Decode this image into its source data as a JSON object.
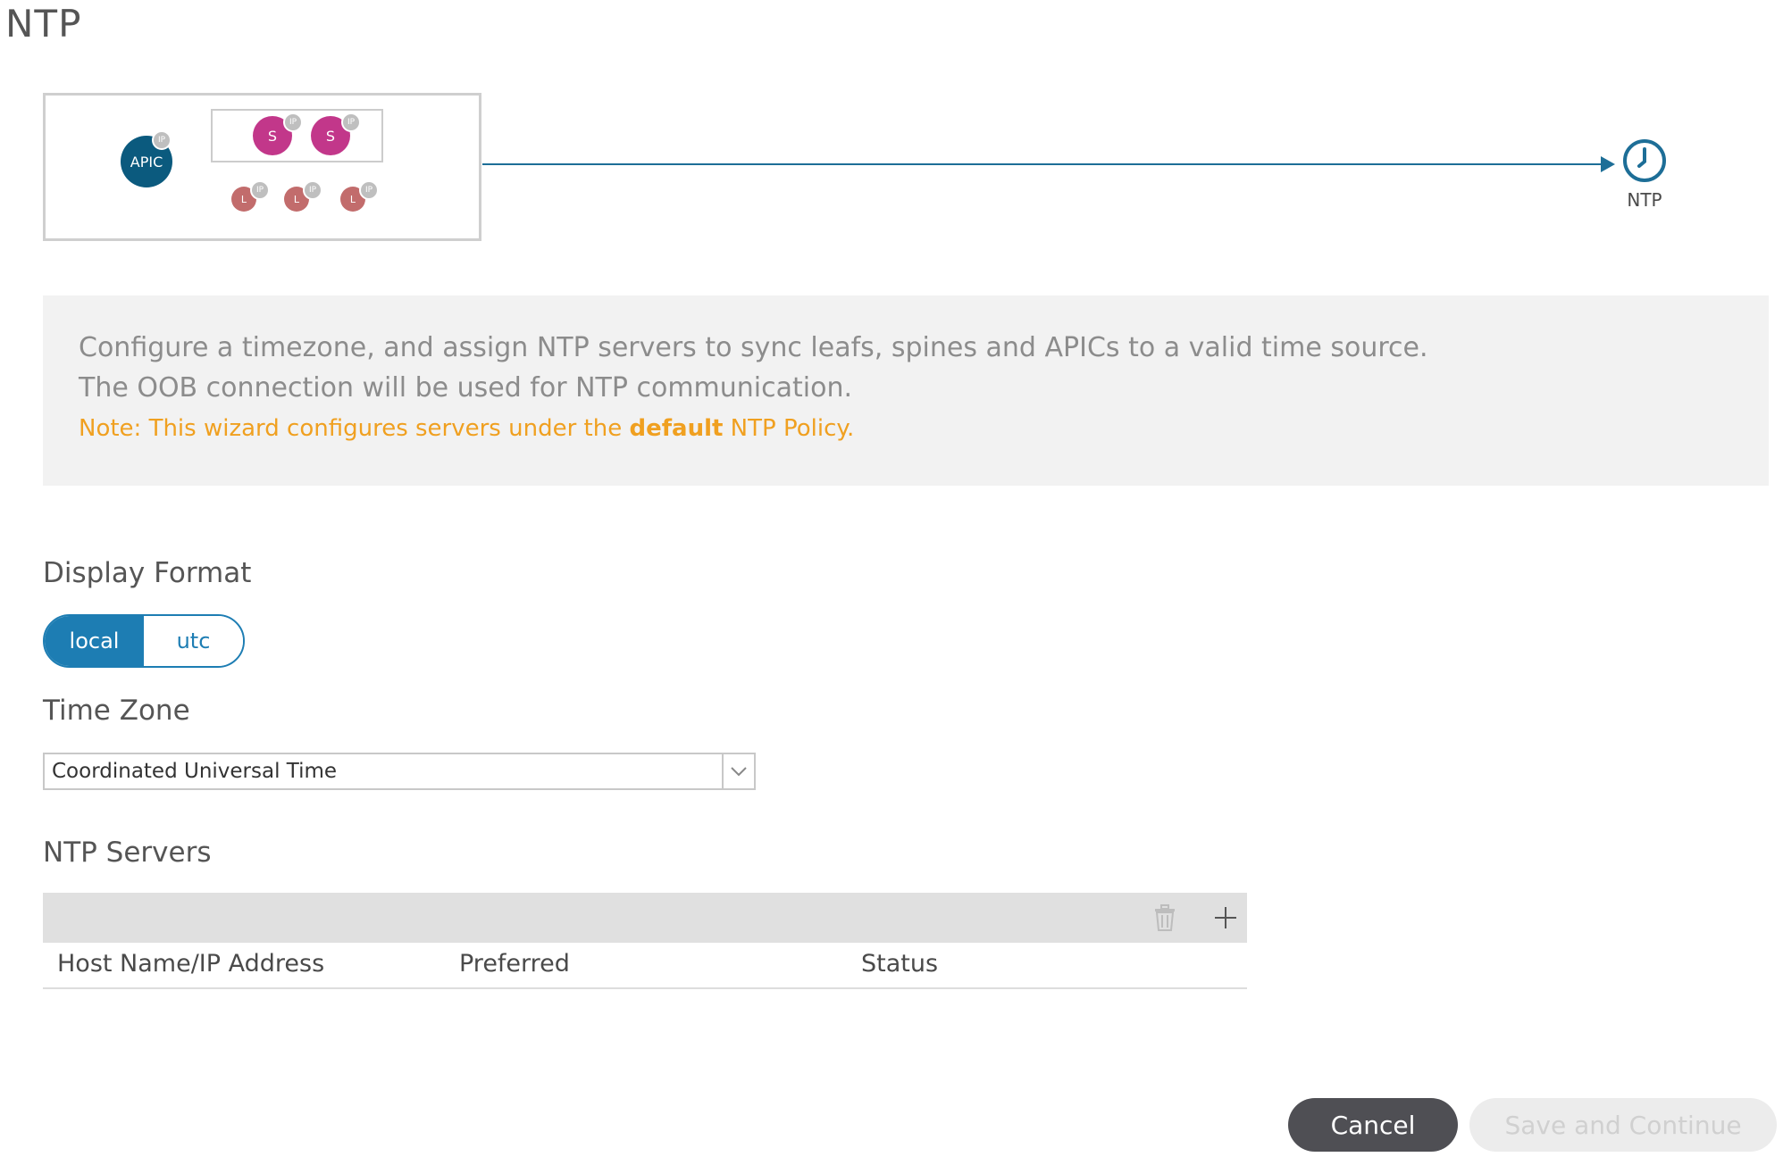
{
  "page": {
    "title": "NTP"
  },
  "topology": {
    "apic_label": "APIC",
    "spine_labels": [
      "S",
      "S"
    ],
    "leaf_labels": [
      "L",
      "L",
      "L"
    ],
    "ip_badge": "IP",
    "target_label": "NTP",
    "colors": {
      "apic": "#0b5a7e",
      "spine": "#c2378a",
      "leaf": "#c26c6c",
      "link": "#1d6e97"
    }
  },
  "info": {
    "line1": "Configure a timezone, and assign NTP servers to sync leafs, spines and APICs to a valid time source.",
    "line2": "The OOB connection will be used for NTP communication.",
    "note_prefix": "Note: This wizard configures servers under the ",
    "note_bold": "default",
    "note_suffix": " NTP Policy."
  },
  "display_format": {
    "label": "Display Format",
    "options": [
      "local",
      "utc"
    ],
    "selected": "local"
  },
  "time_zone": {
    "label": "Time Zone",
    "value": "Coordinated Universal Time"
  },
  "ntp_servers": {
    "label": "NTP Servers",
    "columns": [
      "Host Name/IP Address",
      "Preferred",
      "Status"
    ],
    "rows": [],
    "toolbar_icons": [
      "trash-icon",
      "plus-icon"
    ]
  },
  "footer": {
    "cancel_label": "Cancel",
    "save_label": "Save and Continue"
  },
  "colors": {
    "accent": "#1d7db3",
    "note": "#f0a020",
    "cancel_bg": "#4f4f54",
    "save_disabled_bg": "#ececec"
  }
}
